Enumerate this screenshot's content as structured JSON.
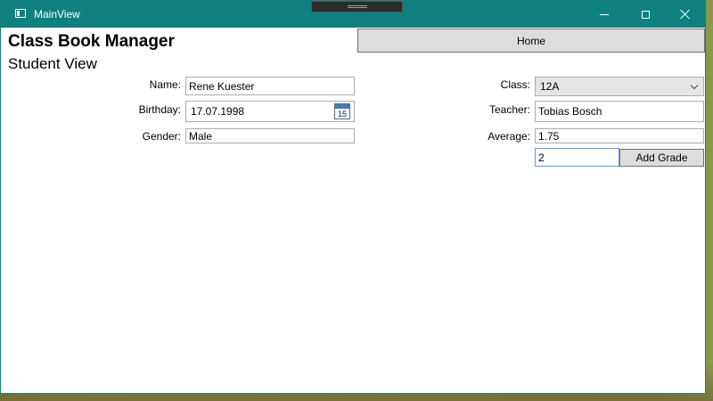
{
  "window": {
    "title": "MainView"
  },
  "header": {
    "app_title": "Class Book Manager",
    "view_title": "Student View",
    "home_label": "Home"
  },
  "student": {
    "name_label": "Name:",
    "name_value": "Rene Kuester",
    "birthday_label": "Birthday:",
    "birthday_value": "17.07.1998",
    "calendar_day": "15",
    "gender_label": "Gender:",
    "gender_value": "Male"
  },
  "class_info": {
    "class_label": "Class:",
    "class_value": "12A",
    "teacher_label": "Teacher:",
    "teacher_value": "Tobias Bosch",
    "average_label": "Average:",
    "average_value": "1.75"
  },
  "grade": {
    "input_value": "2",
    "add_label": "Add Grade"
  },
  "colors": {
    "titlebar": "#0e8080",
    "button_bg": "#dddddd",
    "focus_border": "#569de5"
  },
  "icons": [
    "app-window-icon",
    "minimize-icon",
    "maximize-icon",
    "close-icon",
    "calendar-icon",
    "chevron-down-icon"
  ]
}
